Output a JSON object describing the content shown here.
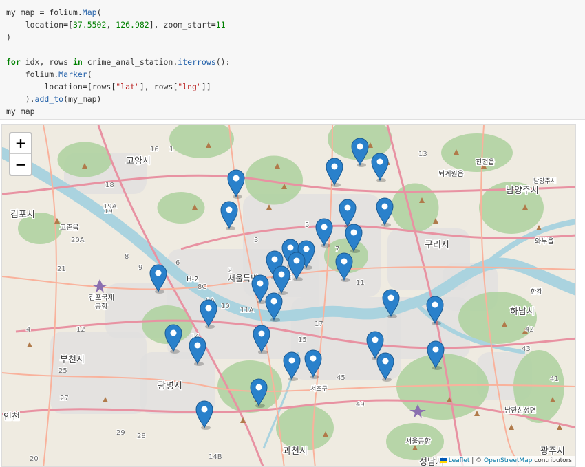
{
  "code_cell": {
    "lines": [
      [
        {
          "t": "my_map = folium."
        },
        {
          "t": "Map",
          "c": "attr"
        },
        {
          "t": "("
        }
      ],
      [
        {
          "t": "    location=["
        },
        {
          "t": "37.5502",
          "c": "num"
        },
        {
          "t": ", "
        },
        {
          "t": "126.982",
          "c": "num"
        },
        {
          "t": "], zoom_start="
        },
        {
          "t": "11",
          "c": "num"
        }
      ],
      [
        {
          "t": ")"
        }
      ],
      [
        {
          "t": ""
        }
      ],
      [
        {
          "t": "for",
          "c": "kw"
        },
        {
          "t": " idx, rows "
        },
        {
          "t": "in",
          "c": "kw"
        },
        {
          "t": " crime_anal_station."
        },
        {
          "t": "iterrows",
          "c": "attr"
        },
        {
          "t": "():"
        }
      ],
      [
        {
          "t": "    folium."
        },
        {
          "t": "Marker",
          "c": "attr"
        },
        {
          "t": "("
        }
      ],
      [
        {
          "t": "        location=[rows["
        },
        {
          "t": "\"lat\"",
          "c": "str"
        },
        {
          "t": "], rows["
        },
        {
          "t": "\"lng\"",
          "c": "str"
        },
        {
          "t": "]]"
        }
      ],
      [
        {
          "t": "    )."
        },
        {
          "t": "add_to",
          "c": "attr"
        },
        {
          "t": "(my_map)"
        }
      ],
      [
        {
          "t": "my_map"
        }
      ]
    ]
  },
  "map": {
    "zoom_in_label": "+",
    "zoom_out_label": "−",
    "attribution": {
      "leaflet": "Leaflet",
      "separator": " | © ",
      "osm": "OpenStreetMap",
      "suffix": " contributors"
    },
    "colors": {
      "land": "#efebe1",
      "water": "#aad3df",
      "forest": "#add19e",
      "urban": "#e0dfdf",
      "motorway": "#e892a2",
      "trunk": "#f9b29c",
      "marker": "#2a81cb"
    },
    "place_labels": [
      {
        "text": "고양시",
        "size": 13
      },
      {
        "text": "김포시",
        "size": 13
      },
      {
        "text": "고촌읍",
        "size": 10
      },
      {
        "text": "김포국제",
        "size": 10
      },
      {
        "text": "공항",
        "size": 10
      },
      {
        "text": "서울특별",
        "size": 12
      },
      {
        "text": "울",
        "size": 12
      },
      {
        "text": "퇴계원읍",
        "size": 10
      },
      {
        "text": "진건읍",
        "size": 10
      },
      {
        "text": "남양주시",
        "size": 13
      },
      {
        "text": "남양주시",
        "size": 9
      },
      {
        "text": "구리시",
        "size": 13
      },
      {
        "text": "와부읍",
        "size": 10
      },
      {
        "text": "하남시",
        "size": 13
      },
      {
        "text": "부천시",
        "size": 13
      },
      {
        "text": "광명시",
        "size": 13
      },
      {
        "text": "인천",
        "size": 13
      },
      {
        "text": "서초구",
        "size": 9
      },
      {
        "text": "서울공항",
        "size": 10
      },
      {
        "text": "과천시",
        "size": 13
      },
      {
        "text": "남한산성면",
        "size": 10
      },
      {
        "text": "광주시",
        "size": 13
      },
      {
        "text": "성남시",
        "size": 13
      },
      {
        "text": "H-2",
        "size": 10
      },
      {
        "text": "한강",
        "size": 9
      }
    ],
    "road_numbers": [
      "16",
      "1",
      "13",
      "18",
      "19",
      "19A",
      "20A",
      "21",
      "4",
      "5",
      "6",
      "8",
      "9",
      "2",
      "3",
      "7",
      "10",
      "11",
      "11A",
      "12",
      "14",
      "15",
      "17",
      "8C",
      "9A",
      "25",
      "27",
      "28",
      "29",
      "41",
      "42",
      "43",
      "45",
      "49",
      "14B",
      "20"
    ],
    "marker_count": 31
  }
}
